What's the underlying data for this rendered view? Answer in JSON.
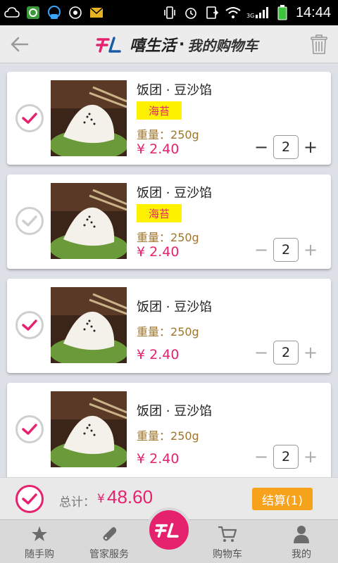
{
  "status_bar": {
    "time": "14:44",
    "network": "3G"
  },
  "header": {
    "brand": "嘻生活",
    "separator": "·",
    "title": "我的购物车"
  },
  "cart": {
    "items": [
      {
        "name": "饭团 · 豆沙馅",
        "tag": "海苔",
        "weight_label": "重量：",
        "weight": "250g",
        "currency": "¥",
        "price": "2.40",
        "qty": "2",
        "checked": true
      },
      {
        "name": "饭团 · 豆沙馅",
        "tag": "海苔",
        "weight_label": "重量：",
        "weight": "250g",
        "currency": "¥",
        "price": "2.40",
        "qty": "2",
        "checked": false
      },
      {
        "name": "饭团 · 豆沙馅",
        "tag": "",
        "weight_label": "重量：",
        "weight": "250g",
        "currency": "¥",
        "price": "2.40",
        "qty": "2",
        "checked": true
      },
      {
        "name": "饭团 · 豆沙馅",
        "tag": "",
        "weight_label": "重量：",
        "weight": "250g",
        "currency": "¥",
        "price": "2.40",
        "qty": "2",
        "checked": true
      }
    ]
  },
  "total": {
    "label": "总计：",
    "currency": "¥",
    "amount": "48.60",
    "checkout_label": "结算(1)"
  },
  "nav": {
    "items": [
      {
        "label": "随手购",
        "icon": "star-icon"
      },
      {
        "label": "管家服务",
        "icon": "wrench-icon"
      },
      {
        "label": "购物车",
        "icon": "cart-icon"
      },
      {
        "label": "我的",
        "icon": "user-icon"
      }
    ],
    "center_icon": "brand-logo-icon"
  },
  "colors": {
    "accent": "#e5226e",
    "checkout": "#f7a21b",
    "tag_bg": "#fff200",
    "weight": "#a0762e"
  }
}
